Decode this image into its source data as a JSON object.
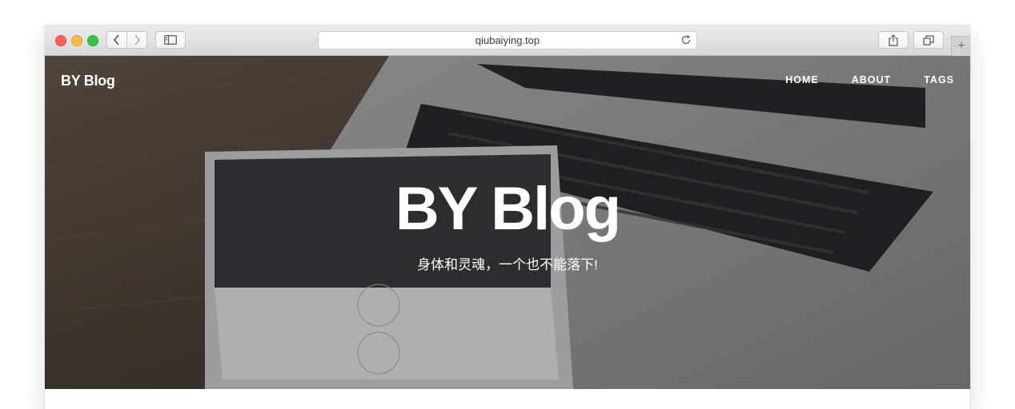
{
  "browser": {
    "url": "qiubaiying.top",
    "new_tab_label": "+"
  },
  "site": {
    "brand": "BY Blog",
    "nav": [
      "HOME",
      "ABOUT",
      "TAGS"
    ],
    "hero_title": "BY Blog",
    "hero_subtitle": "身体和灵魂，一个也不能落下!"
  },
  "icons": {
    "back": "chevron-left-icon",
    "forward": "chevron-right-icon",
    "sidebar": "sidebar-icon",
    "reload": "reload-icon",
    "share": "share-icon",
    "tabs": "tabs-icon"
  },
  "colors": {
    "close": "#fc605b",
    "minimize": "#fdbc40",
    "zoom": "#34c84a"
  }
}
